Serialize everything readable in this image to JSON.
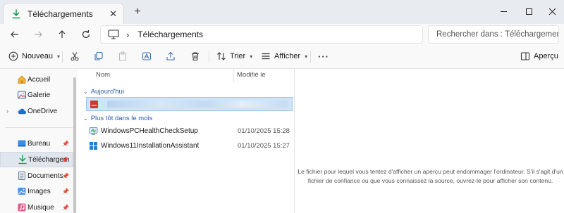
{
  "window": {
    "tab_title": "Téléchargements",
    "new_tab": "+",
    "close_tab": "✕"
  },
  "address": {
    "breadcrumb": "Téléchargements",
    "search_placeholder": "Rechercher dans : Téléchargements"
  },
  "toolbar": {
    "new_label": "Nouveau",
    "sort_label": "Trier",
    "view_label": "Afficher",
    "more": "···",
    "preview_label": "Aperçu"
  },
  "sidebar": {
    "items": [
      {
        "label": "Accueil",
        "icon": "home-icon"
      },
      {
        "label": "Galerie",
        "icon": "gallery-icon"
      },
      {
        "label": "OneDrive",
        "icon": "cloud-icon"
      },
      {
        "label": "Bureau",
        "icon": "desktop-folder-icon"
      },
      {
        "label": "Téléchargements",
        "icon": "download-icon",
        "selected": true
      },
      {
        "label": "Documents",
        "icon": "documents-icon"
      },
      {
        "label": "Images",
        "icon": "images-icon"
      },
      {
        "label": "Musique",
        "icon": "music-icon"
      }
    ]
  },
  "filelist": {
    "columns": {
      "name": "Nom",
      "modified": "Modifié le"
    },
    "groups": [
      {
        "label": "Aujourd'hui"
      },
      {
        "label": "Plus tôt dans le mois"
      }
    ],
    "rows": [
      {
        "name": "WindowsPCHealthCheckSetup",
        "date": "01/10/2025 15:28"
      },
      {
        "name": "Windows11InstallationAssistant",
        "date": "01/10/2025 15:27"
      }
    ]
  },
  "preview": {
    "message_line1": "Le fichier pour lequel vous tentez d'afficher un aperçu peut endommager l'ordinateur. S'il s'agit d'un",
    "message_line2": "fichier de confiance ou que vous connaissez la source, ouvrez-le pour afficher son contenu."
  },
  "colors": {
    "accent": "#2b5ea8",
    "selection": "#cfe4f7",
    "download_green": "#1f9d55"
  }
}
